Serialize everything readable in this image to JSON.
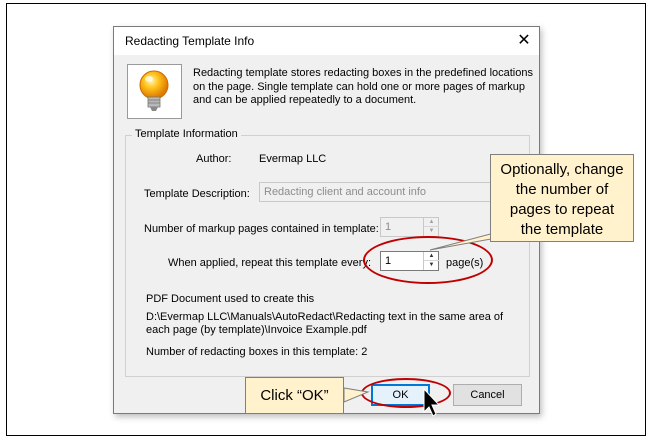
{
  "dialog": {
    "title": "Redacting Template Info",
    "close_glyph": "✕",
    "icon": "lightbulb-icon",
    "description": "Redacting template stores redacting boxes in the predefined locations on the page. Single template can hold one or more pages of markup and can be applied repeatedly to a document."
  },
  "template_info": {
    "group_label": "Template Information",
    "author_label": "Author:",
    "author_value": "Evermap LLC",
    "description_label": "Template Description:",
    "description_value": "Redacting client and account info",
    "markup_pages_label": "Number of markup pages contained in template:",
    "markup_pages_value": "1",
    "repeat_label": "When applied, repeat this template every:",
    "repeat_value": "1",
    "repeat_unit": "page(s)",
    "pdf_label": "PDF Document used to create this",
    "pdf_path": "D:\\Evermap LLC\\Manuals\\AutoRedact\\Redacting text in the same area of each page (by template)\\Invoice Example.pdf",
    "boxes_label": "Number of redacting boxes in this template: 2"
  },
  "buttons": {
    "ok": "OK",
    "cancel": "Cancel"
  },
  "callouts": {
    "change_pages": [
      "Optionally, change",
      "the number of",
      "pages to repeat",
      "the template"
    ],
    "click_ok": "Click “OK”"
  },
  "colors": {
    "callout_fill": "#fff2cc",
    "highlight": "#c00000",
    "accent": "#0078d7"
  }
}
